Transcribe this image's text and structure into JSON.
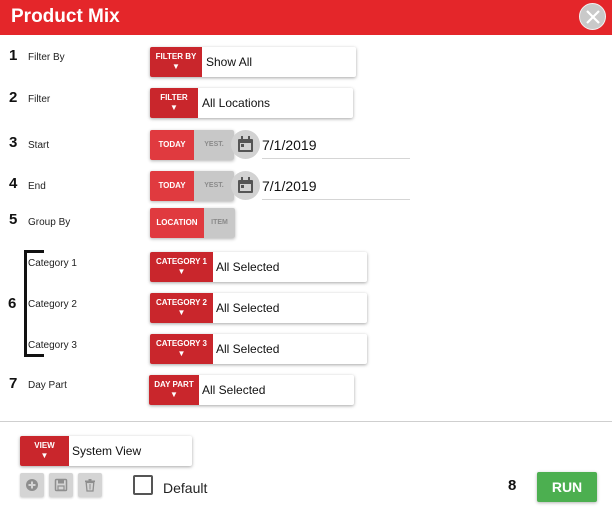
{
  "window": {
    "title": "Product Mix",
    "close_icon": "close-icon"
  },
  "rows": {
    "filter_by": {
      "num": "1",
      "label": "Filter By",
      "button": "FILTER BY",
      "value": "Show All"
    },
    "filter": {
      "num": "2",
      "label": "Filter",
      "button": "FILTER",
      "value": "All Locations"
    },
    "start": {
      "num": "3",
      "label": "Start",
      "today": "TODAY",
      "yest": "YEST.",
      "value": "7/1/2019"
    },
    "end": {
      "num": "4",
      "label": "End",
      "today": "TODAY",
      "yest": "YEST.",
      "value": "7/1/2019"
    },
    "group_by": {
      "num": "5",
      "label": "Group By",
      "option_active": "LOCATION",
      "option_inactive": "ITEM"
    },
    "categories": {
      "num": "6",
      "category1": {
        "label": "Category 1",
        "button": "CATEGORY 1",
        "value": "All Selected"
      },
      "category2": {
        "label": "Category 2",
        "button": "CATEGORY 2",
        "value": "All Selected"
      },
      "category3": {
        "label": "Category 3",
        "button": "CATEGORY 3",
        "value": "All Selected"
      }
    },
    "day_part": {
      "num": "7",
      "label": "Day Part",
      "button": "DAY PART",
      "value": "All Selected"
    }
  },
  "footer": {
    "view_button": "VIEW",
    "view_value": "System View",
    "default_label": "Default",
    "default_checked": false,
    "run_num": "8",
    "run_label": "RUN"
  },
  "colors": {
    "header": "#e4262a",
    "accent_red": "#c9262c",
    "toggle_red": "#e03a3f",
    "run_green": "#4caf50"
  },
  "arrow_glyph": "▼"
}
